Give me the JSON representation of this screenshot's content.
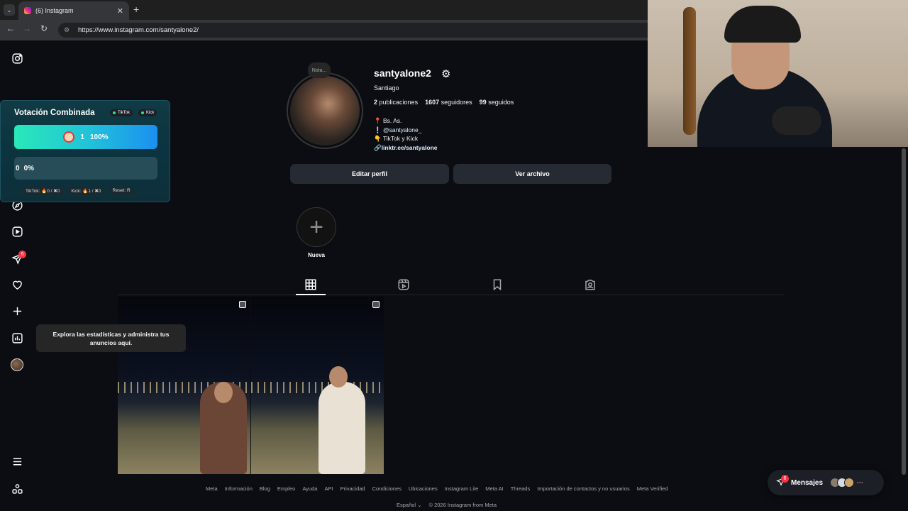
{
  "browser": {
    "tab_title": "(6) Instagram",
    "tab_close": "✕",
    "new_tab": "+",
    "url": "https://www.instagram.com/santyalone2/"
  },
  "widget": {
    "title": "Votación Combinada",
    "tags": [
      "TikTok",
      "Kick"
    ],
    "option1_value": "1",
    "option1_pct": "100%",
    "option1_fill": 1.0,
    "option2_value": "0",
    "option2_pct": "0%",
    "stats": [
      "TikTok: 🔥0 / ✖0",
      "Kick: 🔥1 / ✖0",
      "Reset: R"
    ]
  },
  "sidebar": {
    "notification_count": "6"
  },
  "profile": {
    "note": "Nota...",
    "username": "santyalone2",
    "full_name": "Santiago",
    "posts_count": "2",
    "posts_label": "publicaciones",
    "followers_count": "1607",
    "followers_label": "seguidores",
    "following_count": "99",
    "following_label": "seguidos",
    "bio_location": "Bs. As.",
    "bio_mention": "@santyalone_",
    "bio_platforms": "TikTok y Kick",
    "bio_link": "linktr.ee/santyalone",
    "edit_button": "Editar perfil",
    "archive_button": "Ver archivo",
    "highlight_label": "Nueva"
  },
  "tooltip": {
    "text": "Explora las estadísticas y administra tus anuncios aquí."
  },
  "footer": {
    "links": [
      "Meta",
      "Información",
      "Blog",
      "Empleo",
      "Ayuda",
      "API",
      "Privacidad",
      "Condiciones",
      "Ubicaciones",
      "Instagram Lite",
      "Meta AI",
      "Threads",
      "Importación de contactos y no usuarios",
      "Meta Verified"
    ],
    "language": "Español",
    "copyright": "© 2026 Instagram from Meta"
  },
  "messages": {
    "label": "Mensajes",
    "count": "6"
  }
}
